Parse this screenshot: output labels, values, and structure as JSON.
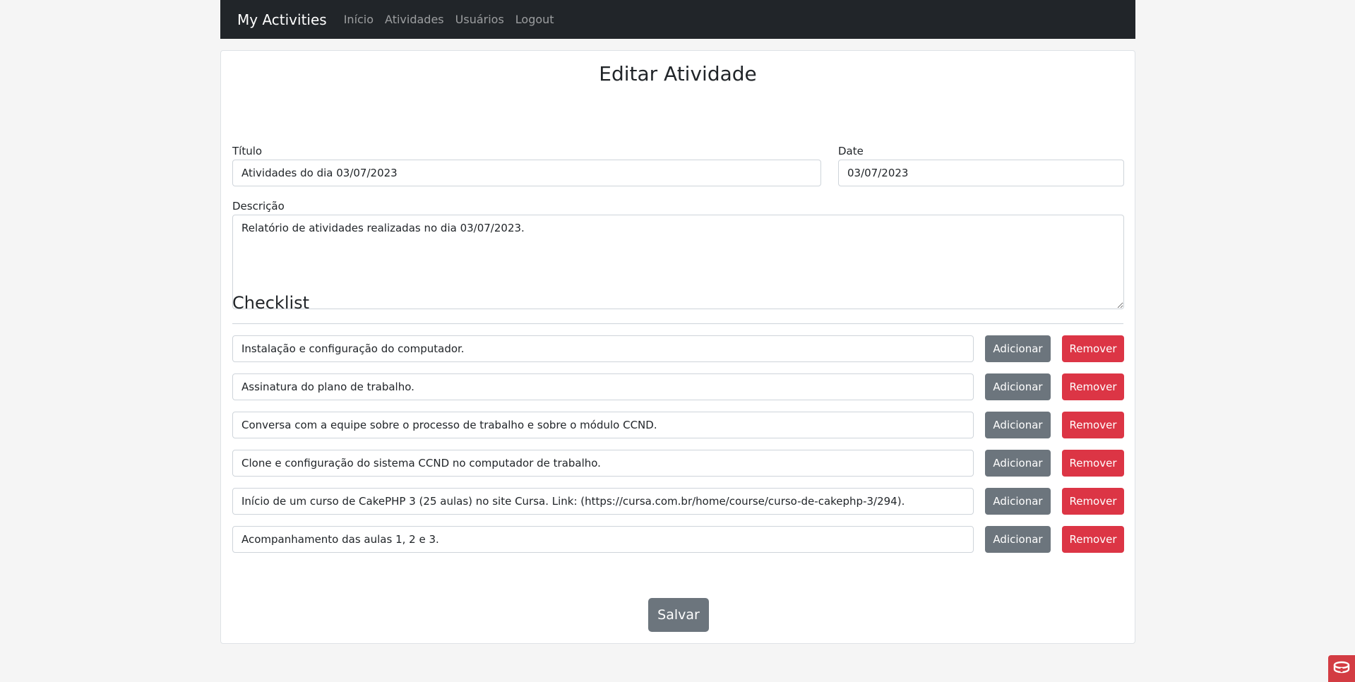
{
  "navbar": {
    "brand": "My Activities",
    "links": [
      "Início",
      "Atividades",
      "Usuários",
      "Logout"
    ]
  },
  "form": {
    "page_title": "Editar Atividade",
    "title_label": "Título",
    "title_value": "Atividades do dia 03/07/2023",
    "date_label": "Date",
    "date_value": "03/07/2023",
    "description_label": "Descrição",
    "description_value": "Relatório de atividades realizadas no dia 03/07/2023."
  },
  "checklist": {
    "heading": "Checklist",
    "add_label": "Adicionar",
    "remove_label": "Remover",
    "items": [
      "Instalação e configuração do computador.",
      "Assinatura do plano de trabalho.",
      "Conversa com a equipe sobre o processo de trabalho e sobre o módulo CCND.",
      "Clone e configuração do sistema CCND no computador de trabalho.",
      "Início de um curso de CakePHP 3 (25 aulas) no site Cursa. Link: (https://cursa.com.br/home/course/curso-de-cakephp-3/294).",
      "Acompanhamento das aulas 1, 2 e 3."
    ]
  },
  "actions": {
    "save_label": "Salvar"
  },
  "colors": {
    "navbar_bg": "#212529",
    "secondary_button": "#6c757d",
    "danger_button": "#dc3545",
    "corner_badge": "#d33c43"
  },
  "icons": {
    "corner_badge": "cakephp-debug-icon"
  }
}
